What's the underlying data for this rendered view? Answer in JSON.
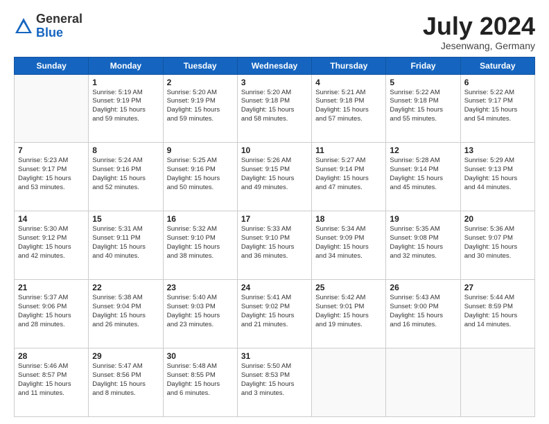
{
  "header": {
    "logo_general": "General",
    "logo_blue": "Blue",
    "month_year": "July 2024",
    "location": "Jesenwang, Germany"
  },
  "weekdays": [
    "Sunday",
    "Monday",
    "Tuesday",
    "Wednesday",
    "Thursday",
    "Friday",
    "Saturday"
  ],
  "weeks": [
    [
      {
        "day": "",
        "text": ""
      },
      {
        "day": "1",
        "text": "Sunrise: 5:19 AM\nSunset: 9:19 PM\nDaylight: 15 hours\nand 59 minutes."
      },
      {
        "day": "2",
        "text": "Sunrise: 5:20 AM\nSunset: 9:19 PM\nDaylight: 15 hours\nand 59 minutes."
      },
      {
        "day": "3",
        "text": "Sunrise: 5:20 AM\nSunset: 9:18 PM\nDaylight: 15 hours\nand 58 minutes."
      },
      {
        "day": "4",
        "text": "Sunrise: 5:21 AM\nSunset: 9:18 PM\nDaylight: 15 hours\nand 57 minutes."
      },
      {
        "day": "5",
        "text": "Sunrise: 5:22 AM\nSunset: 9:18 PM\nDaylight: 15 hours\nand 55 minutes."
      },
      {
        "day": "6",
        "text": "Sunrise: 5:22 AM\nSunset: 9:17 PM\nDaylight: 15 hours\nand 54 minutes."
      }
    ],
    [
      {
        "day": "7",
        "text": "Sunrise: 5:23 AM\nSunset: 9:17 PM\nDaylight: 15 hours\nand 53 minutes."
      },
      {
        "day": "8",
        "text": "Sunrise: 5:24 AM\nSunset: 9:16 PM\nDaylight: 15 hours\nand 52 minutes."
      },
      {
        "day": "9",
        "text": "Sunrise: 5:25 AM\nSunset: 9:16 PM\nDaylight: 15 hours\nand 50 minutes."
      },
      {
        "day": "10",
        "text": "Sunrise: 5:26 AM\nSunset: 9:15 PM\nDaylight: 15 hours\nand 49 minutes."
      },
      {
        "day": "11",
        "text": "Sunrise: 5:27 AM\nSunset: 9:14 PM\nDaylight: 15 hours\nand 47 minutes."
      },
      {
        "day": "12",
        "text": "Sunrise: 5:28 AM\nSunset: 9:14 PM\nDaylight: 15 hours\nand 45 minutes."
      },
      {
        "day": "13",
        "text": "Sunrise: 5:29 AM\nSunset: 9:13 PM\nDaylight: 15 hours\nand 44 minutes."
      }
    ],
    [
      {
        "day": "14",
        "text": "Sunrise: 5:30 AM\nSunset: 9:12 PM\nDaylight: 15 hours\nand 42 minutes."
      },
      {
        "day": "15",
        "text": "Sunrise: 5:31 AM\nSunset: 9:11 PM\nDaylight: 15 hours\nand 40 minutes."
      },
      {
        "day": "16",
        "text": "Sunrise: 5:32 AM\nSunset: 9:10 PM\nDaylight: 15 hours\nand 38 minutes."
      },
      {
        "day": "17",
        "text": "Sunrise: 5:33 AM\nSunset: 9:10 PM\nDaylight: 15 hours\nand 36 minutes."
      },
      {
        "day": "18",
        "text": "Sunrise: 5:34 AM\nSunset: 9:09 PM\nDaylight: 15 hours\nand 34 minutes."
      },
      {
        "day": "19",
        "text": "Sunrise: 5:35 AM\nSunset: 9:08 PM\nDaylight: 15 hours\nand 32 minutes."
      },
      {
        "day": "20",
        "text": "Sunrise: 5:36 AM\nSunset: 9:07 PM\nDaylight: 15 hours\nand 30 minutes."
      }
    ],
    [
      {
        "day": "21",
        "text": "Sunrise: 5:37 AM\nSunset: 9:06 PM\nDaylight: 15 hours\nand 28 minutes."
      },
      {
        "day": "22",
        "text": "Sunrise: 5:38 AM\nSunset: 9:04 PM\nDaylight: 15 hours\nand 26 minutes."
      },
      {
        "day": "23",
        "text": "Sunrise: 5:40 AM\nSunset: 9:03 PM\nDaylight: 15 hours\nand 23 minutes."
      },
      {
        "day": "24",
        "text": "Sunrise: 5:41 AM\nSunset: 9:02 PM\nDaylight: 15 hours\nand 21 minutes."
      },
      {
        "day": "25",
        "text": "Sunrise: 5:42 AM\nSunset: 9:01 PM\nDaylight: 15 hours\nand 19 minutes."
      },
      {
        "day": "26",
        "text": "Sunrise: 5:43 AM\nSunset: 9:00 PM\nDaylight: 15 hours\nand 16 minutes."
      },
      {
        "day": "27",
        "text": "Sunrise: 5:44 AM\nSunset: 8:59 PM\nDaylight: 15 hours\nand 14 minutes."
      }
    ],
    [
      {
        "day": "28",
        "text": "Sunrise: 5:46 AM\nSunset: 8:57 PM\nDaylight: 15 hours\nand 11 minutes."
      },
      {
        "day": "29",
        "text": "Sunrise: 5:47 AM\nSunset: 8:56 PM\nDaylight: 15 hours\nand 8 minutes."
      },
      {
        "day": "30",
        "text": "Sunrise: 5:48 AM\nSunset: 8:55 PM\nDaylight: 15 hours\nand 6 minutes."
      },
      {
        "day": "31",
        "text": "Sunrise: 5:50 AM\nSunset: 8:53 PM\nDaylight: 15 hours\nand 3 minutes."
      },
      {
        "day": "",
        "text": ""
      },
      {
        "day": "",
        "text": ""
      },
      {
        "day": "",
        "text": ""
      }
    ]
  ]
}
